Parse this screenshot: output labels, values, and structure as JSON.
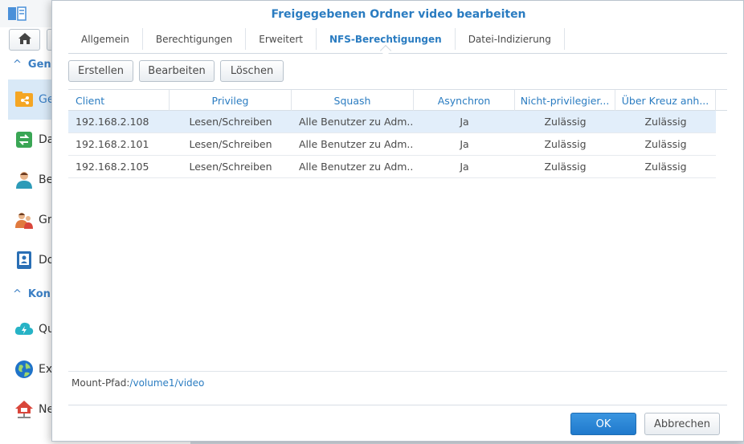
{
  "background": {
    "sidebar": {
      "sections": [
        {
          "label": "Gen"
        },
        {
          "label": "Kon"
        }
      ],
      "items": [
        {
          "label": "Ge",
          "icon": "shared-folder-icon",
          "color": "#f5a623"
        },
        {
          "label": "Da",
          "icon": "file-services-icon",
          "color": "#3aa655"
        },
        {
          "label": "Be",
          "icon": "user-icon",
          "color": "#2d9bb8"
        },
        {
          "label": "Gr",
          "icon": "group-icon",
          "color": "#e07a3e"
        },
        {
          "label": "Do",
          "icon": "domain-icon",
          "color": "#2a6fb5"
        },
        {
          "label": "Qu",
          "icon": "quickconnect-icon",
          "color": "#27b3c6"
        },
        {
          "label": "Ex",
          "icon": "external-access-icon",
          "color": "#1f73c9"
        },
        {
          "label": "Ne",
          "icon": "network-icon",
          "color": "#d9463b"
        }
      ]
    }
  },
  "dialog": {
    "title": "Freigegebenen Ordner video bearbeiten",
    "tabs": [
      {
        "label": "Allgemein"
      },
      {
        "label": "Berechtigungen"
      },
      {
        "label": "Erweitert"
      },
      {
        "label": "NFS-Berechtigungen",
        "active": true
      },
      {
        "label": "Datei-Indizierung"
      }
    ],
    "toolbar": {
      "create_label": "Erstellen",
      "edit_label": "Bearbeiten",
      "delete_label": "Löschen"
    },
    "table": {
      "columns": [
        "Client",
        "Privileg",
        "Squash",
        "Asynchron",
        "Nicht-privilegier...",
        "Über Kreuz anh..."
      ],
      "rows": [
        [
          "192.168.2.108",
          "Lesen/Schreiben",
          "Alle Benutzer zu Adm...",
          "Ja",
          "Zulässig",
          "Zulässig"
        ],
        [
          "192.168.2.101",
          "Lesen/Schreiben",
          "Alle Benutzer zu Adm...",
          "Ja",
          "Zulässig",
          "Zulässig"
        ],
        [
          "192.168.2.105",
          "Lesen/Schreiben",
          "Alle Benutzer zu Adm...",
          "Ja",
          "Zulässig",
          "Zulässig"
        ]
      ]
    },
    "mount": {
      "label": "Mount-Pfad:",
      "path": "/volume1/video"
    },
    "footer": {
      "ok_label": "OK",
      "cancel_label": "Abbrechen"
    },
    "colors": {
      "accent": "#2a7cc1",
      "selected_row": "#e2eefa",
      "ok_button": "#2583d2"
    }
  }
}
